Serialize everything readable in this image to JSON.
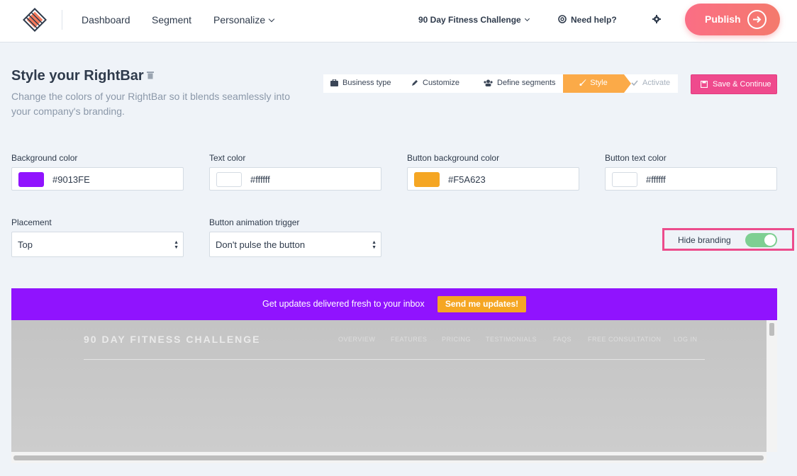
{
  "nav": {
    "links": [
      "Dashboard",
      "Segment",
      "Personalize"
    ],
    "site_selector": "90 Day Fitness Challenge",
    "help": "Need help?",
    "publish": "Publish"
  },
  "header": {
    "title": "Style your RightBar",
    "subtitle": "Change the colors of your RightBar so it blends seamlessly into your company's branding."
  },
  "steps": {
    "items": [
      "Business type",
      "Customize",
      "Define segments",
      "Style",
      "Activate"
    ],
    "active": "Style",
    "save_label": "Save & Continue"
  },
  "form": {
    "background_color": {
      "label": "Background color",
      "value": "#9013FE"
    },
    "text_color": {
      "label": "Text color",
      "value": "#ffffff"
    },
    "button_bg_color": {
      "label": "Button background color",
      "value": "#F5A623"
    },
    "button_text_color": {
      "label": "Button text color",
      "value": "#ffffff"
    },
    "placement": {
      "label": "Placement",
      "value": "Top"
    },
    "animation": {
      "label": "Button animation trigger",
      "value": "Don't pulse the button"
    },
    "hide_branding": {
      "label": "Hide branding",
      "on": true
    }
  },
  "preview": {
    "bar_text": "Get updates delivered fresh to your inbox",
    "bar_button": "Send me updates!",
    "site_title": "90 DAY FITNESS CHALLENGE",
    "site_nav": [
      "OVERVIEW",
      "FEATURES",
      "PRICING",
      "TESTIMONIALS",
      "FAQS",
      "FREE CONSULTATION",
      "LOG IN"
    ]
  },
  "colors": {
    "bar_bg": "#9013fe",
    "bar_button": "#f5a623",
    "accent_pink": "#ec4c8c",
    "step_active": "#fbaa48",
    "toggle_on": "#7ecf92"
  }
}
